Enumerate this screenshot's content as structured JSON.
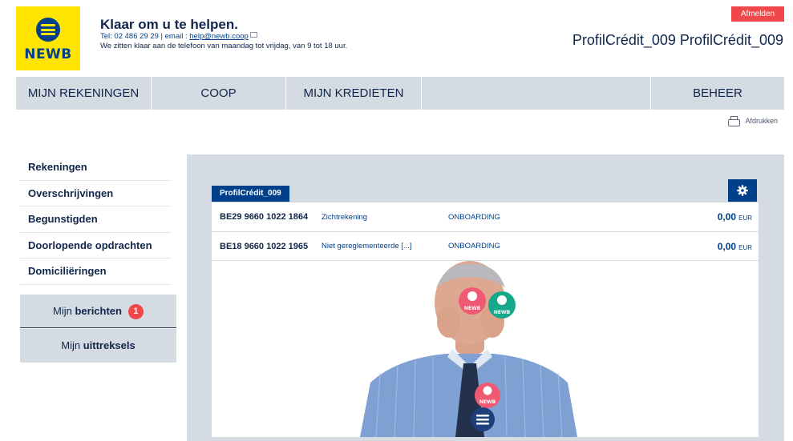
{
  "logo": {
    "text": "NEWB"
  },
  "contact": {
    "title": "Klaar om u te helpen.",
    "phone_prefix": "Tel: 02 486 29 29 | email : ",
    "email": "help@newb.coop",
    "hours": "We zitten klaar aan de telefoon van maandag tot vrijdag, van 9 tot 18 uur."
  },
  "header": {
    "logout_label": "Afmelden",
    "user_name": "ProfilCrédit_009 ProfilCrédit_009"
  },
  "nav": {
    "items": [
      "MIJN REKENINGEN",
      "COOP",
      "MIJN KREDIETEN",
      "BEHEER"
    ]
  },
  "print": {
    "label": "Afdrukken"
  },
  "sidebar": {
    "items": [
      "Rekeningen",
      "Overschrijvingen",
      "Begunstigden",
      "Doorlopende opdrachten",
      "Domiciliëringen"
    ],
    "messages_prefix": "Mijn ",
    "messages_bold": "berichten",
    "messages_count": "1",
    "statements_prefix": "Mijn ",
    "statements_bold": "uittreksels"
  },
  "accounts": {
    "group_label": "ProfilCrédit_009",
    "rows": [
      {
        "iban": "BE29 9660 1022 1864",
        "type": "Zichtrekening",
        "status": "ONBOARDING",
        "amount": "0,00",
        "currency": "EUR"
      },
      {
        "iban": "BE18 9660 1022 1965",
        "type": "Niet gereglementeerde [...]",
        "status": "ONBOARDING",
        "amount": "0,00",
        "currency": "EUR"
      }
    ]
  },
  "promo": {
    "badge_text": "NEWB"
  },
  "colors": {
    "brand_yellow": "#ffe500",
    "brand_blue": "#003f8a",
    "alert_red": "#f0474a",
    "nav_grey": "#d5dbe3"
  }
}
